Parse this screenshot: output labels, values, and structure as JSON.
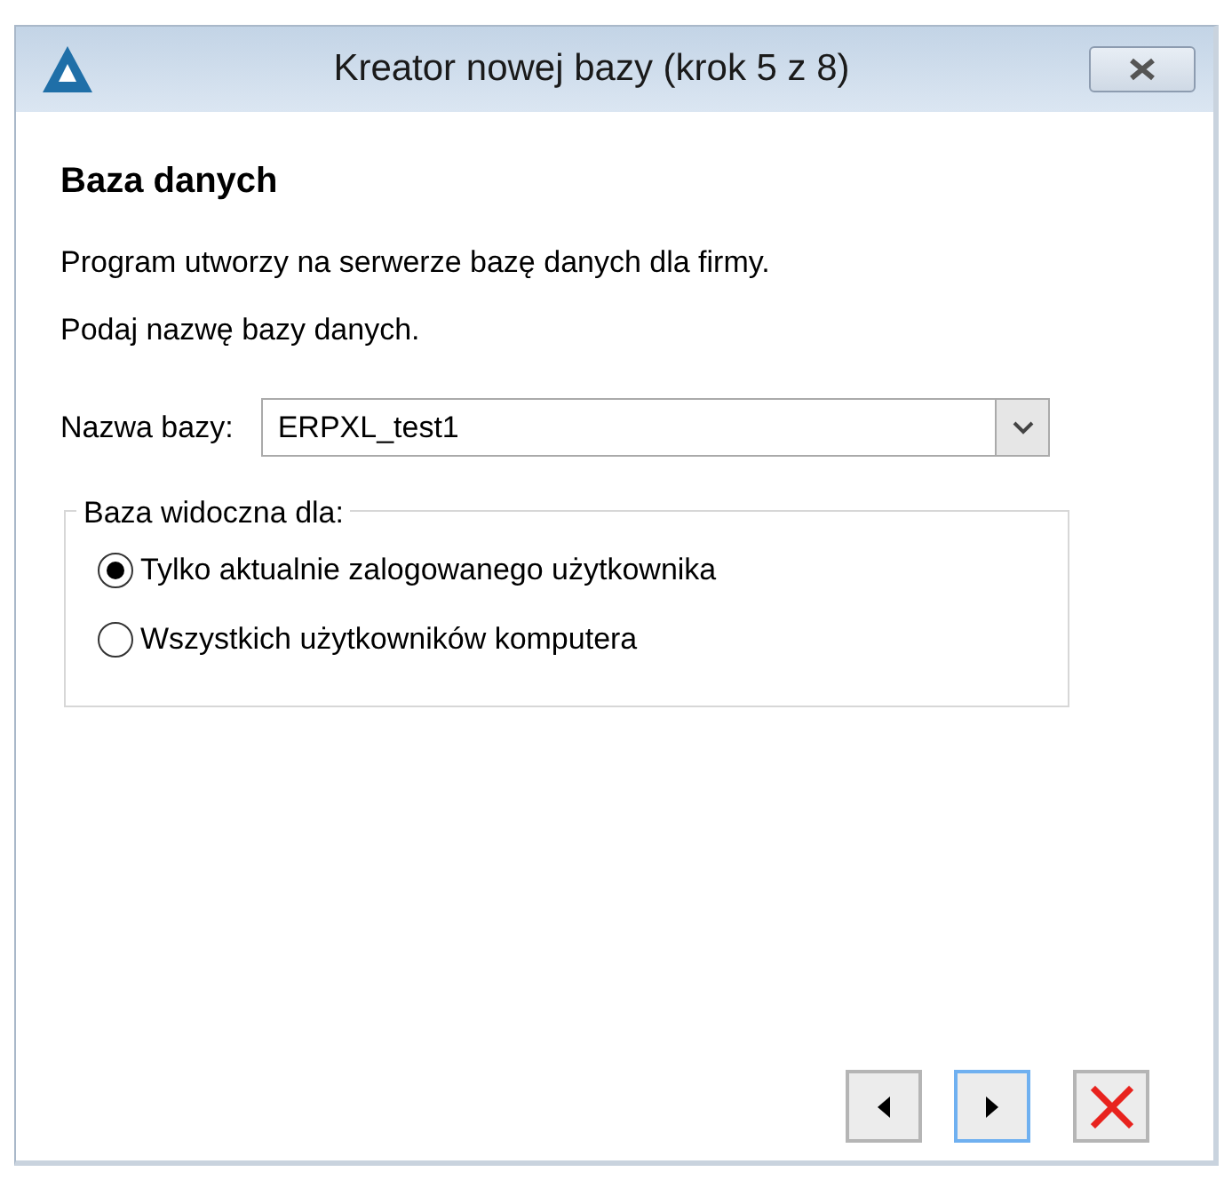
{
  "window": {
    "title": "Kreator nowej bazy (krok 5 z 8)"
  },
  "heading": "Baza danych",
  "paragraphs": [
    "Program utworzy na serwerze bazę danych dla firmy.",
    "Podaj nazwę bazy danych."
  ],
  "database_name": {
    "label": "Nazwa bazy:",
    "value": "ERPXL_test1"
  },
  "visibility": {
    "legend": "Baza widoczna dla:",
    "options": [
      {
        "label": "Tylko aktualnie zalogowanego użytkownika",
        "selected": true
      },
      {
        "label": "Wszystkich użytkowników komputera",
        "selected": false
      }
    ]
  },
  "buttons": [
    {
      "kind": "back",
      "focused": false
    },
    {
      "kind": "next",
      "focused": true
    },
    {
      "kind": "cancel",
      "focused": false
    }
  ]
}
